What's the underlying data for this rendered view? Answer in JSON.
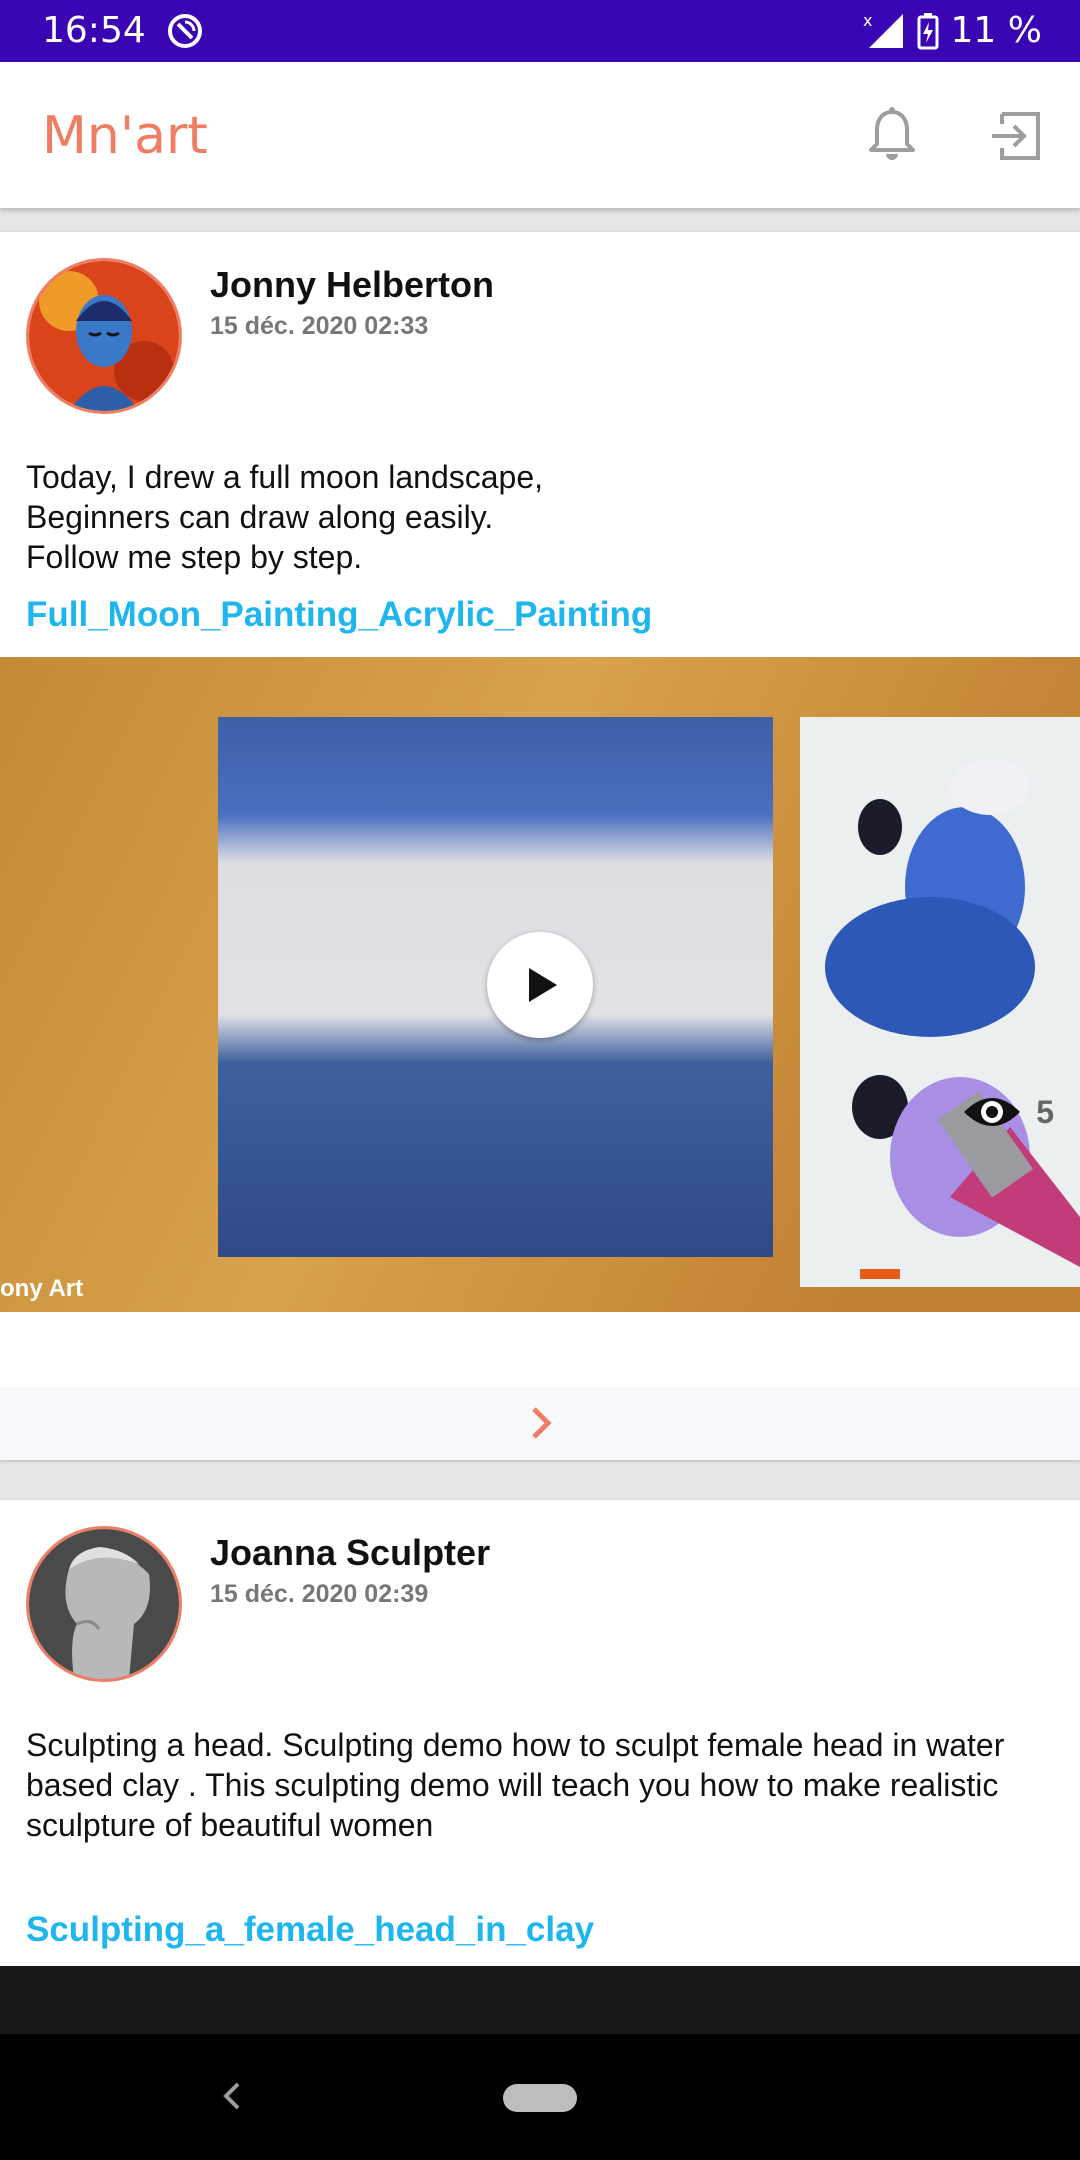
{
  "status_bar": {
    "time": "16:54",
    "battery": "11 %",
    "icons": [
      "app-notification-icon",
      "no-signal-icon",
      "battery-charging-icon"
    ]
  },
  "app_bar": {
    "title": "Mn'art",
    "title_color": "#ef7d63",
    "icons": [
      "bell-icon",
      "logout-icon"
    ]
  },
  "posts": [
    {
      "author": "Jonny Helberton",
      "date": "15 déc. 2020 02:33",
      "text": "Today, I drew a full moon landscape,\nBeginners can draw along easily.\nFollow me step by step.",
      "link": "Full_Moon_Painting_Acrylic_Painting",
      "video_watermark": "ony Art",
      "views": "5"
    },
    {
      "author": "Joanna Sculpter",
      "date": "15 déc. 2020 02:39",
      "text": "Sculpting a head. Sculpting demo how to sculpt female head in water based clay . This sculpting demo will teach you how to make realistic sculpture of beautiful women",
      "link": "Sculpting_a_female_head_in_clay"
    }
  ],
  "colors": {
    "status_bar": "#3a06b3",
    "accent": "#ef7d63",
    "link": "#1eb6ef"
  }
}
